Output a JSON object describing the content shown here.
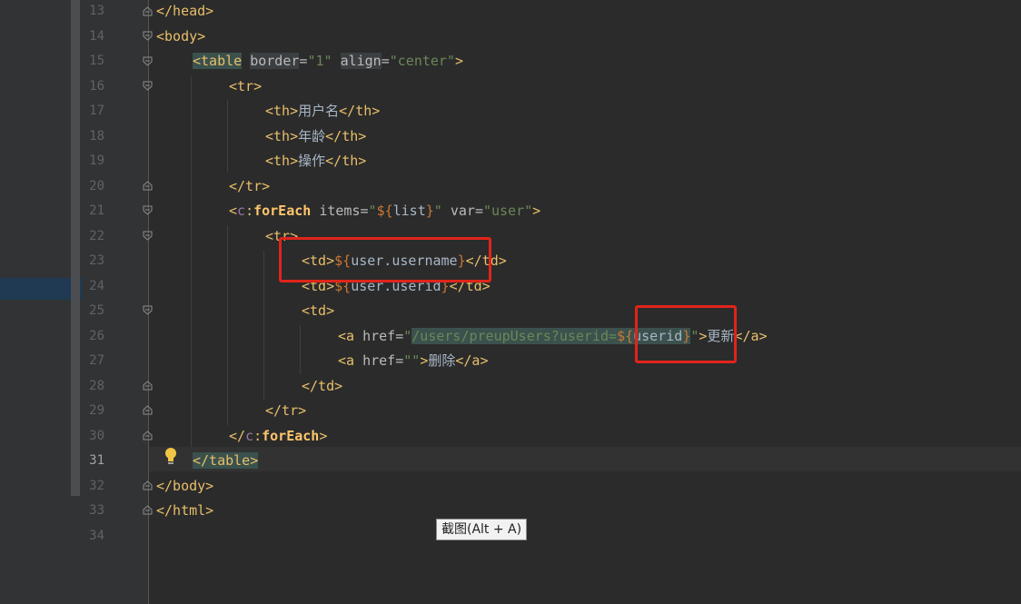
{
  "gutter": {
    "line_numbers": [
      "13",
      "14",
      "15",
      "16",
      "17",
      "18",
      "19",
      "20",
      "21",
      "22",
      "23",
      "24",
      "25",
      "26",
      "27",
      "28",
      "29",
      "30",
      "31",
      "32",
      "33",
      "34"
    ]
  },
  "code": {
    "l13": {
      "tag": "</head>"
    },
    "l14": {
      "tag": "<body>"
    },
    "l15": {
      "open": "<table",
      "attr1": "border",
      "eq1": "=",
      "val1": "\"1\"",
      "attr2": "align",
      "eq2": "=",
      "val2": "\"center\"",
      "close": ">"
    },
    "l16": {
      "tag": "<tr>"
    },
    "l17": {
      "open": "<th>",
      "text": "用户名",
      "close": "</th>"
    },
    "l18": {
      "open": "<th>",
      "text": "年龄",
      "close": "</th>"
    },
    "l19": {
      "open": "<th>",
      "text": "操作",
      "close": "</th>"
    },
    "l20": {
      "tag": "</tr>"
    },
    "l21": {
      "lt": "<",
      "ns": "c",
      "colon": ":",
      "name": "forEach",
      "attr1": "items",
      "eq1": "=",
      "q1": "\"",
      "el1a": "${",
      "el1b": "list",
      "el1c": "}",
      "q1e": "\"",
      "attr2": "var",
      "eq2": "=",
      "val2": "\"user\"",
      "close": ">"
    },
    "l22": {
      "tag": "<tr>"
    },
    "l23": {
      "open": "<td>",
      "ela": "${",
      "elb": "user.username",
      "elc": "}",
      "close": "</td>"
    },
    "l24": {
      "open": "<td>",
      "ela": "${",
      "elb": "user.userid",
      "elc": "}",
      "close": "</td>"
    },
    "l25": {
      "tag": "<td>"
    },
    "l26": {
      "open": "<a",
      "attr": "href",
      "eq": "=",
      "q": "\"",
      "path": "/users/preupUsers?userid=",
      "ela": "${",
      "elb": "userid",
      "elc": "}",
      "qe": "\"",
      "gt": ">",
      "text": "更新",
      "close": "</a>"
    },
    "l27": {
      "open": "<a",
      "attr": "href",
      "eq": "=",
      "val": "\"\"",
      "gt": ">",
      "text": "删除",
      "close": "</a>"
    },
    "l28": {
      "tag": "</td>"
    },
    "l29": {
      "tag": "</tr>"
    },
    "l30": {
      "lt": "</",
      "ns": "c",
      "colon": ":",
      "name": "forEach",
      "close": ">"
    },
    "l31": {
      "tag": "</table>"
    },
    "l32": {
      "tag": "</body>"
    },
    "l33": {
      "tag": "</html>"
    }
  },
  "tooltip": {
    "text": "截图(Alt + A)"
  },
  "colors": {
    "background": "#2b2b2b",
    "tag": "#e8bf6a",
    "string": "#6a8759",
    "el": "#cc7832",
    "highlight_box": "#e0241b"
  },
  "icons": {
    "intention": "lightbulb-icon",
    "fold": "fold-marker-icon"
  }
}
